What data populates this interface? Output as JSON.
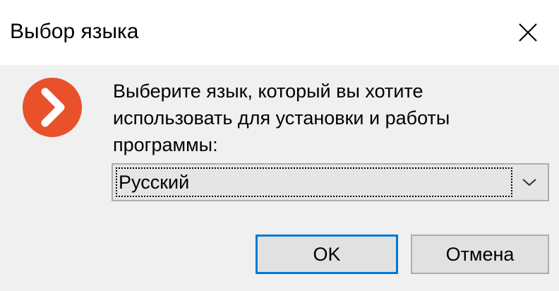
{
  "window": {
    "title": "Выбор языка"
  },
  "icons": {
    "close": "close-icon",
    "app": "arrow-right-circle-icon",
    "dropdown": "chevron-down-icon"
  },
  "colors": {
    "app_icon": "#e8512a",
    "accent_border": "#0078d7"
  },
  "dialog": {
    "message_lines": [
      "Выберите язык, который вы хотите",
      "использовать для установки и работы",
      "программы:"
    ],
    "language_select": {
      "value": "Русский"
    },
    "buttons": {
      "ok": "OK",
      "cancel": "Отмена"
    }
  }
}
